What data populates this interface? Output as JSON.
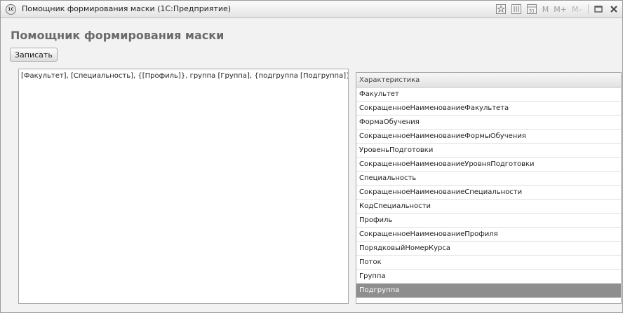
{
  "window": {
    "app_badge": "1С",
    "title": "Помощник формирования маски  (1С:Предприятие)"
  },
  "toolbar_icons": [
    "favorite-icon",
    "calculator-icon",
    "calendar-icon"
  ],
  "memory_buttons": [
    "M",
    "M+",
    "M–"
  ],
  "form": {
    "title": "Помощник формирования маски",
    "save_label": "Записать",
    "mask_value": "[Факультет], [Специальность], {[Профиль]}, группа [Группа], {подгруппа [Подгруппа]}"
  },
  "table": {
    "column_header": "Характеристика",
    "rows": [
      "Факультет",
      "СокращенноеНаименованиеФакультета",
      "ФормаОбучения",
      "СокращенноеНаименованиеФормыОбучения",
      "УровеньПодготовки",
      "СокращенноеНаименованиеУровняПодготовки",
      "Специальность",
      "СокращенноеНаименованиеСпециальности",
      "КодСпециальности",
      "Профиль",
      "СокращенноеНаименованиеПрофиля",
      "ПорядковыйНомерКурса",
      "Поток",
      "Группа",
      "Подгруппа"
    ],
    "selected_row": "Подгруппа"
  }
}
